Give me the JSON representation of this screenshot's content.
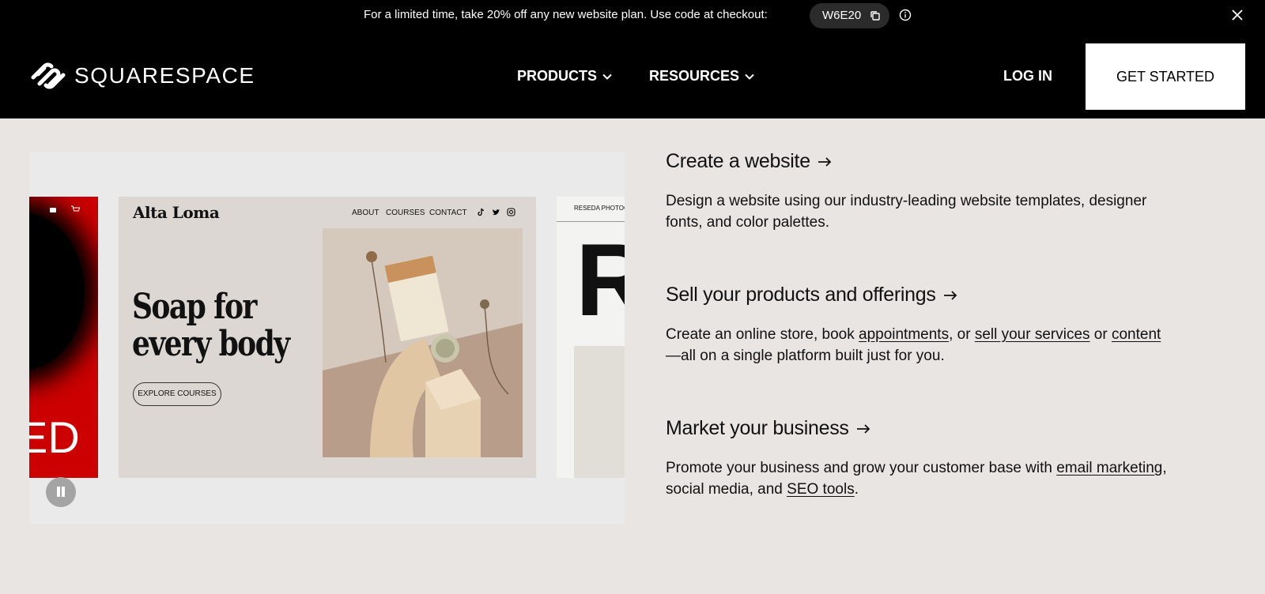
{
  "promo": {
    "text": "For a limited time, take 20% off any new website plan. Use code at checkout:",
    "code": "W6E20",
    "copy_icon": "copy-icon",
    "info_icon": "info-icon",
    "close_icon": "close-icon"
  },
  "header": {
    "logo_text": "SQUARESPACE",
    "nav": [
      {
        "label": "PRODUCTS"
      },
      {
        "label": "RESOURCES"
      }
    ],
    "login": "LOG IN",
    "cta": "GET STARTED"
  },
  "showcase": {
    "card_left_text": "ED",
    "card_main": {
      "brand": "Alta Loma",
      "nav": [
        "ABOUT",
        "COURSES",
        "CONTACT"
      ],
      "headline_line1": "Soap for",
      "headline_line2": "every body",
      "button": "EXPLORE COURSES"
    },
    "card_right": {
      "label": "RESEDA PHOTOGRAPHY",
      "big_letter": "R"
    }
  },
  "features": [
    {
      "title": "Create a website",
      "desc": "Design a website using our industry-leading website templates, designer fonts, and color palettes."
    },
    {
      "title": "Sell your products and offerings",
      "desc_parts": [
        "Create an online store, book ",
        "appointments",
        ", or ",
        "sell your services",
        " or ",
        "content",
        "—all on a single platform built just for you."
      ]
    },
    {
      "title": "Market your business",
      "desc_parts": [
        "Promote your business and grow your customer base with ",
        "email marketing",
        ", social media, and ",
        "SEO tools",
        "."
      ]
    }
  ],
  "colors": {
    "header_bg": "#000000",
    "page_bg": "#e8e5e3",
    "accent_red": "#cc0000"
  }
}
